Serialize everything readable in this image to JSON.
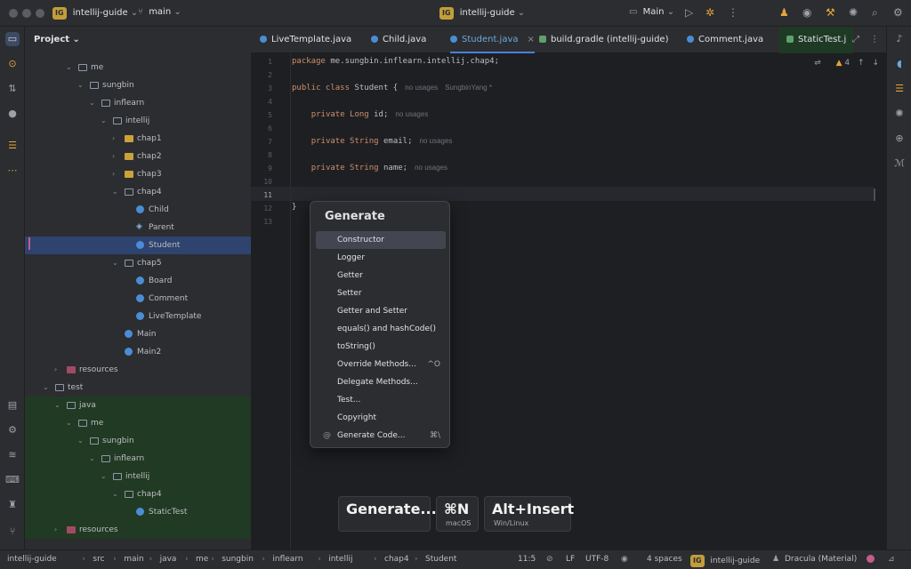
{
  "titlebar": {
    "project_badge": "IG",
    "project_name": "intellij-guide",
    "branch": "main",
    "center_badge": "IG",
    "center_project": "intellij-guide",
    "run_config": "Main"
  },
  "project_panel": {
    "title": "Project",
    "tree": [
      {
        "label": "me",
        "level": 5,
        "kind": "folder",
        "expanded": true
      },
      {
        "label": "sungbin",
        "level": 6,
        "kind": "folder",
        "expanded": true
      },
      {
        "label": "inflearn",
        "level": 7,
        "kind": "folder",
        "expanded": true
      },
      {
        "label": "intellij",
        "level": 8,
        "kind": "folder",
        "expanded": true
      },
      {
        "label": "chap1",
        "level": 9,
        "kind": "yfolder",
        "expanded": false
      },
      {
        "label": "chap2",
        "level": 9,
        "kind": "yfolder",
        "expanded": false
      },
      {
        "label": "chap3",
        "level": 9,
        "kind": "yfolder",
        "expanded": false
      },
      {
        "label": "chap4",
        "level": 9,
        "kind": "folder",
        "expanded": true
      },
      {
        "label": "Child",
        "level": 10,
        "kind": "class"
      },
      {
        "label": "Parent",
        "level": 10,
        "kind": "iface"
      },
      {
        "label": "Student",
        "level": 10,
        "kind": "class",
        "selected": true
      },
      {
        "label": "chap5",
        "level": 9,
        "kind": "folder",
        "expanded": true
      },
      {
        "label": "Board",
        "level": 10,
        "kind": "class"
      },
      {
        "label": "Comment",
        "level": 10,
        "kind": "class"
      },
      {
        "label": "LiveTemplate",
        "level": 10,
        "kind": "class"
      },
      {
        "label": "Main",
        "level": 9,
        "kind": "class"
      },
      {
        "label": "Main2",
        "level": 9,
        "kind": "class"
      },
      {
        "label": "resources",
        "level": 4,
        "kind": "mfolder",
        "expanded": false
      },
      {
        "label": "test",
        "level": 3,
        "kind": "folder",
        "expanded": true
      },
      {
        "label": "java",
        "level": 4,
        "kind": "folder",
        "expanded": true,
        "green": true
      },
      {
        "label": "me",
        "level": 5,
        "kind": "folder",
        "expanded": true,
        "green": true
      },
      {
        "label": "sungbin",
        "level": 6,
        "kind": "folder",
        "expanded": true,
        "green": true
      },
      {
        "label": "inflearn",
        "level": 7,
        "kind": "folder",
        "expanded": true,
        "green": true
      },
      {
        "label": "intellij",
        "level": 8,
        "kind": "folder",
        "expanded": true,
        "green": true
      },
      {
        "label": "chap4",
        "level": 9,
        "kind": "folder",
        "expanded": true,
        "green": true
      },
      {
        "label": "StaticTest",
        "level": 10,
        "kind": "class",
        "green": true
      },
      {
        "label": "resources",
        "level": 4,
        "kind": "mfolder",
        "green": true
      }
    ]
  },
  "tabs": [
    {
      "label": "LiveTemplate.java",
      "active": false
    },
    {
      "label": "Child.java",
      "active": false
    },
    {
      "label": "Student.java",
      "active": true
    },
    {
      "label": "build.gradle (intellij-guide)",
      "active": false
    },
    {
      "label": "Comment.java",
      "active": false
    },
    {
      "label": "StaticTest.j",
      "active": false
    }
  ],
  "editor": {
    "warning_count": "4",
    "lines": [
      "1",
      "2",
      "3",
      "4",
      "5",
      "6",
      "7",
      "8",
      "9",
      "10",
      "11",
      "12",
      "13"
    ],
    "code": {
      "l1_kw": "package",
      "l1_rest": " me.sungbin.inflearn.intellij.chap4;",
      "l3_kw": "public class",
      "l3_rest": " Student {",
      "l3_hint": "no usages",
      "l3_author": "SungbinYang *",
      "l5_kw": "private",
      "l5_type": " Long",
      "l5_rest": " id;",
      "l5_hint": "no usages",
      "l7_kw": "private",
      "l7_type": " String",
      "l7_rest": " email;",
      "l7_hint": "no usages",
      "l9_kw": "private",
      "l9_type": " String",
      "l9_rest": " name;",
      "l9_hint": "no usages",
      "l12": "}"
    }
  },
  "generate_popup": {
    "title": "Generate",
    "items": [
      {
        "label": "Constructor",
        "selected": true
      },
      {
        "label": "Logger"
      },
      {
        "label": "Getter"
      },
      {
        "label": "Setter"
      },
      {
        "label": "Getter and Setter"
      },
      {
        "label": "equals() and hashCode()"
      },
      {
        "label": "toString()"
      },
      {
        "label": "Override Methods...",
        "shortcut": "^O"
      },
      {
        "label": "Delegate Methods..."
      },
      {
        "label": "Test..."
      },
      {
        "label": "Copyright"
      },
      {
        "label": "Generate Code...",
        "shortcut": "⌘\\",
        "icon": "@"
      }
    ]
  },
  "key_hints": {
    "action": "Generate...",
    "mac_key": "⌘N",
    "mac_label": "macOS",
    "win_key": "Alt+Insert",
    "win_label": "Win/Linux"
  },
  "statusbar": {
    "breadcrumb": [
      "intellij-guide",
      "src",
      "main",
      "java",
      "me",
      "sungbin",
      "inflearn",
      "intellij",
      "chap4",
      "Student"
    ],
    "position": "11:5",
    "line_ending": "LF",
    "encoding": "UTF-8",
    "indent": "4 spaces",
    "project_badge": "IG",
    "project": "intellij-guide",
    "theme": "Dracula (Material)"
  }
}
